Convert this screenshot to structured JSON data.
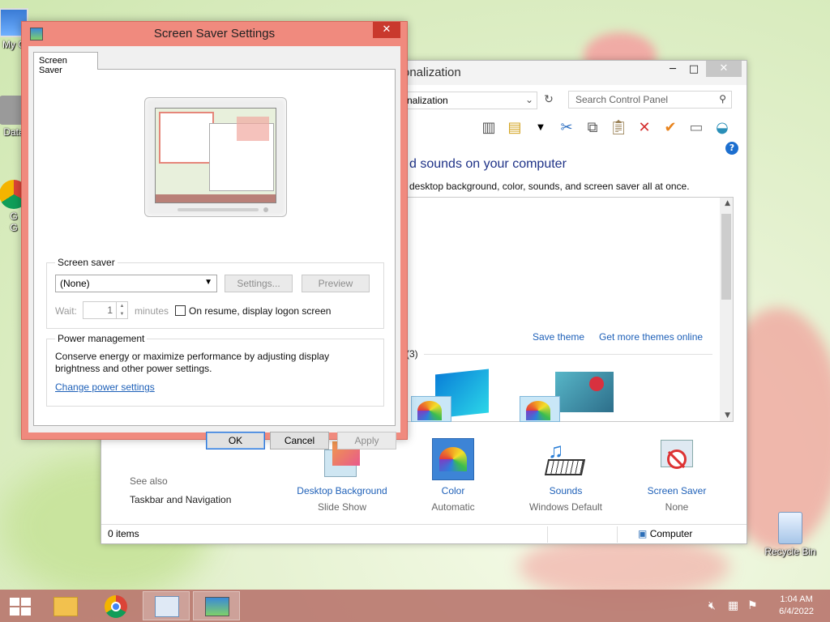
{
  "desktop": {
    "icons": [
      {
        "label": "My C",
        "id": "my-computer"
      },
      {
        "label": "Data",
        "id": "data"
      },
      {
        "label": "G\nG",
        "id": "g-shortcut"
      },
      {
        "label": "Recycle Bin",
        "id": "recycle-bin"
      }
    ]
  },
  "control_panel": {
    "title_partial": "onalization",
    "address_partial": "nalization",
    "search_placeholder": "Search Control Panel",
    "heading_partial": "d sounds on your computer",
    "subtitle_partial": "desktop background, color, sounds, and screen saver all at once.",
    "save_theme": "Save theme",
    "get_more_themes": "Get more themes online",
    "theme_count": "(3)",
    "see_also": "See also",
    "taskbar_nav": "Taskbar and Navigation",
    "bottom_items": [
      {
        "label": "Desktop Background",
        "value": "Slide Show"
      },
      {
        "label": "Color",
        "value": "Automatic"
      },
      {
        "label": "Sounds",
        "value": "Windows Default"
      },
      {
        "label": "Screen Saver",
        "value": "None"
      }
    ],
    "status_items": "0 items",
    "status_computer": "Computer"
  },
  "dialog": {
    "title": "Screen Saver Settings",
    "tab": "Screen Saver",
    "screen_saver_group": "Screen saver",
    "selected_saver": "(None)",
    "settings_btn": "Settings...",
    "preview_btn": "Preview",
    "wait_label": "Wait:",
    "wait_value": "1",
    "minutes_label": "minutes",
    "on_resume_label": "On resume, display logon screen",
    "on_resume_checked": false,
    "power_group": "Power management",
    "power_text": "Conserve energy or maximize performance by adjusting display brightness and other power settings.",
    "power_link": "Change power settings",
    "ok": "OK",
    "cancel": "Cancel",
    "apply": "Apply"
  },
  "taskbar": {
    "time": "1:04 AM",
    "date": "6/4/2022"
  }
}
